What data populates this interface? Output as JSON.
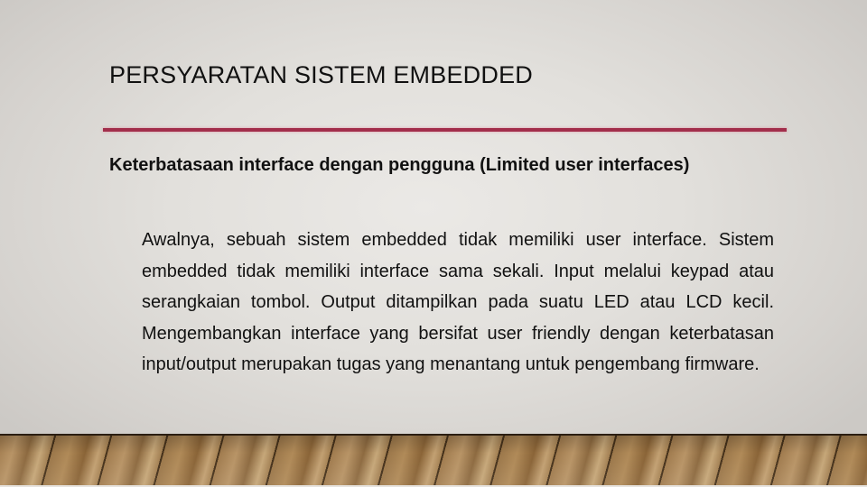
{
  "slide": {
    "title": "PERSYARATAN SISTEM EMBEDDED",
    "accent_color": "#a22e4b",
    "heading": "Keterbatasaan interface dengan pengguna (Limited user interfaces)",
    "body": "Awalnya, sebuah sistem embedded tidak memiliki user interface. Sistem embedded tidak memiliki interface sama sekali. Input melalui keypad atau serangkaian tombol. Output ditampilkan pada suatu LED atau LCD kecil. Mengembangkan interface yang bersifat user friendly dengan keterbatasan input/output merupakan tugas yang menantang untuk pengembang firmware."
  },
  "background": {
    "theme": "wood-floor",
    "wall_color": "#e2e0dc",
    "floor_color": "#a58150"
  }
}
